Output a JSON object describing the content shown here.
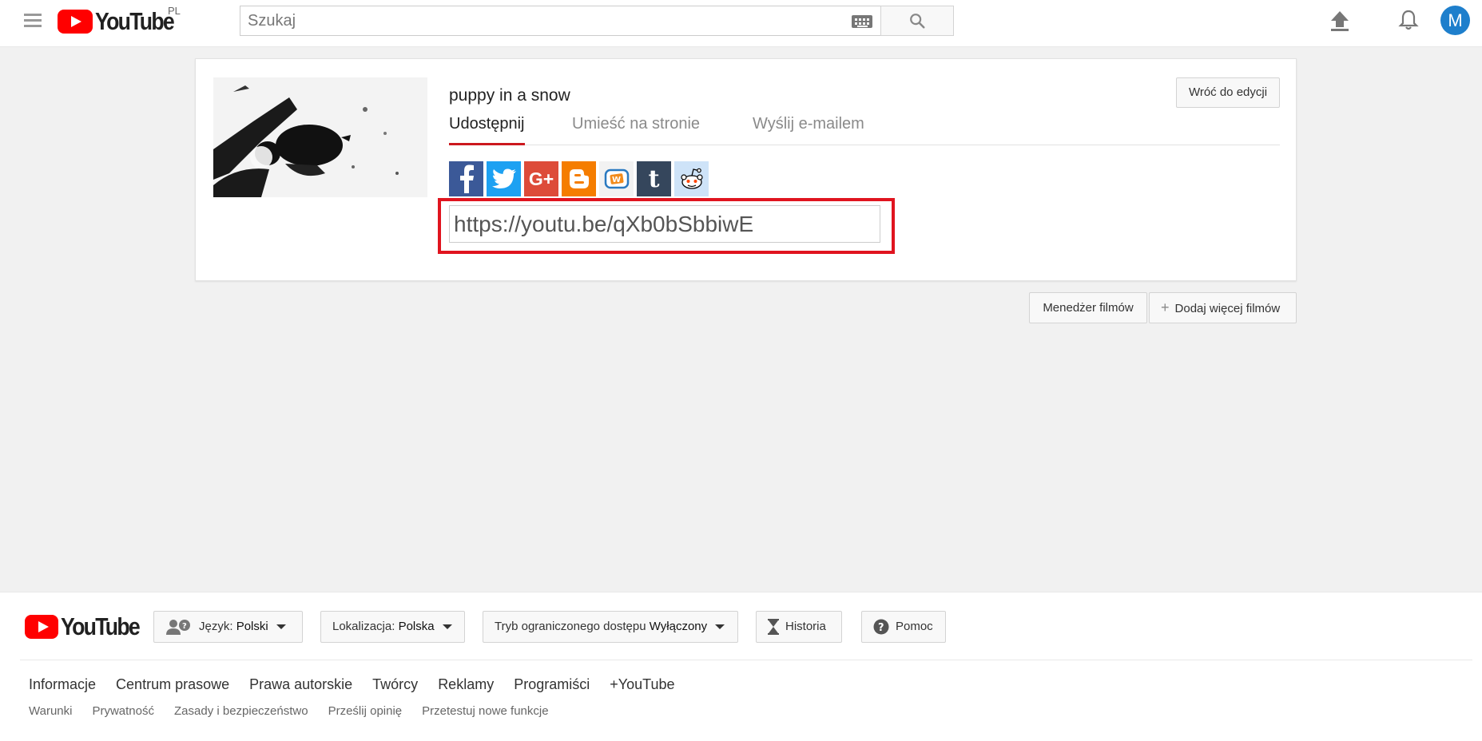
{
  "masthead": {
    "logo_text": "YouTube",
    "region": "PL",
    "search": {
      "placeholder": "Szukaj",
      "value": ""
    },
    "avatar_letter": "M"
  },
  "video": {
    "title": "puppy in a snow",
    "back_button": "Wróć do edycji"
  },
  "tabs": [
    {
      "label": "Udostępnij",
      "active": true
    },
    {
      "label": "Umieść na stronie",
      "active": false
    },
    {
      "label": "Wyślij e-mailem",
      "active": false
    }
  ],
  "social": [
    "facebook-icon",
    "twitter-icon",
    "google-plus-icon",
    "blogger-icon",
    "vkontakte-icon",
    "tumblr-icon",
    "reddit-icon"
  ],
  "share_url": "https://youtu.be/qXb0bSbbiwE",
  "actions": {
    "manager": "Menedżer filmów",
    "add_more": "Dodaj więcej filmów"
  },
  "footer": {
    "logo_text": "YouTube",
    "language_label": "Język:",
    "language_value": "Polski",
    "location_label": "Lokalizacja:",
    "location_value": "Polska",
    "mode_label": "Tryb ograniczonego dostępu",
    "mode_value": "Wyłączony",
    "history": "Historia",
    "help": "Pomoc",
    "links_primary": [
      "Informacje",
      "Centrum prasowe",
      "Prawa autorskie",
      "Twórcy",
      "Reklamy",
      "Programiści",
      "+YouTube"
    ],
    "links_secondary": [
      "Warunki",
      "Prywatność",
      "Zasady i bezpieczeństwo",
      "Prześlij opinię",
      "Przetestuj nowe funkcje"
    ]
  },
  "colors": {
    "brand_red": "#ff0000",
    "tab_underline": "#cc181e",
    "highlight": "#e0141f",
    "avatar": "#1e7fcc"
  }
}
